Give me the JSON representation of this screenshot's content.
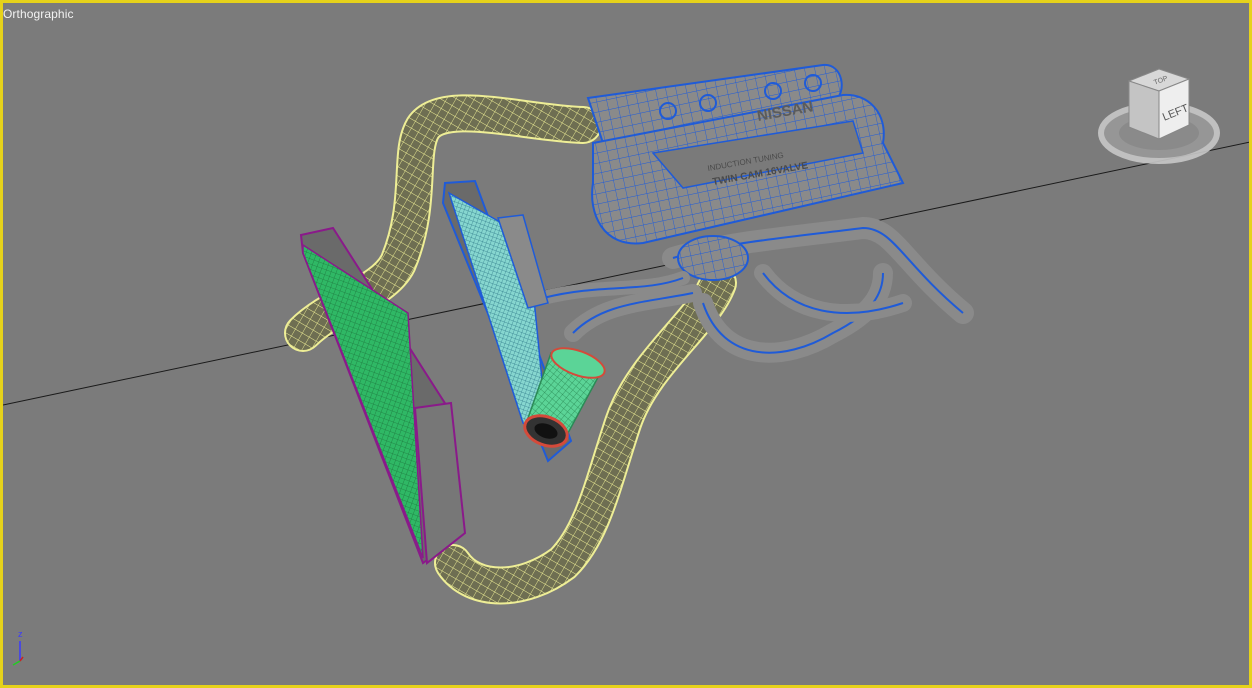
{
  "viewport": {
    "view_label": "Orthographic",
    "border_color": "#e6d21a",
    "background": "#7b7b7b"
  },
  "viewcube": {
    "face_front": "LEFT",
    "face_top": "TOP"
  },
  "axis_tripod": {
    "z_label": "z"
  },
  "engine": {
    "logo_text": "NISSAN",
    "sub_text": "INDUCTION TUNING",
    "cover_text": "TWIN CAM 16VALVE",
    "wire_color": "#1f5bd8"
  },
  "colors": {
    "pipe_wire": "#f0f08c",
    "intercooler_frame": "#8a1a8a",
    "intercooler_core": "#33c46b",
    "radiator_core": "#7fd8d0",
    "filter": "#58d896",
    "filter_ring": "#d44a3a"
  }
}
